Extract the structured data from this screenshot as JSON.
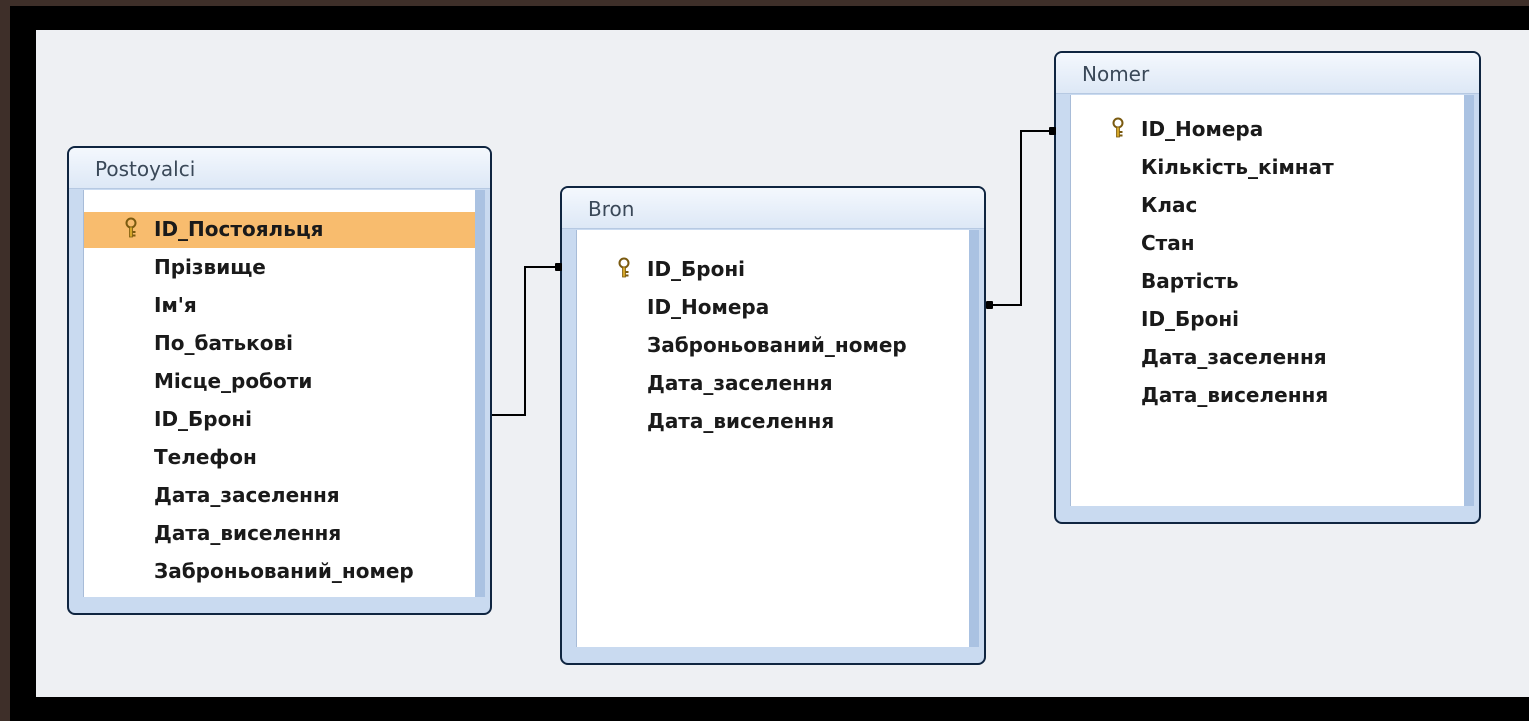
{
  "tables": {
    "postoyalci": {
      "title": "Postoyalci",
      "fields": [
        "ID_Постояльця",
        "Прізвище",
        "Ім'я",
        "По_батькові",
        "Місце_роботи",
        "ID_Броні",
        "Телефон",
        "Дата_заселення",
        "Дата_виселення",
        "Заброньований_номер"
      ]
    },
    "bron": {
      "title": "Bron",
      "fields": [
        "ID_Броні",
        "ID_Номера",
        "Заброньований_номер",
        "Дата_заселення",
        "Дата_виселення"
      ]
    },
    "nomer": {
      "title": "Nomer",
      "fields": [
        "ID_Номера",
        "Кількість_кімнат",
        "Клас",
        "Стан",
        "Вартість",
        "ID_Броні",
        "Дата_заселення",
        "Дата_виселення"
      ]
    }
  },
  "colors": {
    "selected_row": "#f8bc6e",
    "key_icon": "#d4a62a",
    "table_border": "#0f2540",
    "canvas": "#eef0f3"
  },
  "icons": {
    "primary_key": "key-icon"
  }
}
